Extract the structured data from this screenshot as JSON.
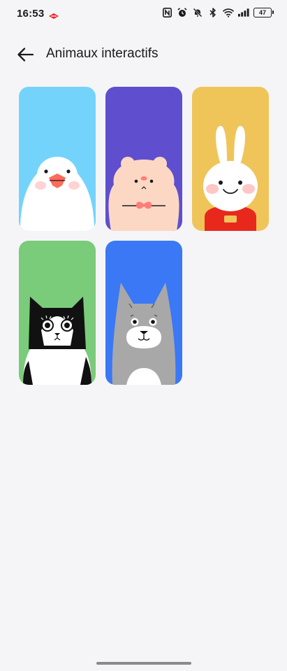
{
  "status": {
    "time": "16:53",
    "battery": "47"
  },
  "header": {
    "title": "Animaux interactifs"
  },
  "wallpapers": [
    {
      "name": "bird",
      "bg": "#74d3fb"
    },
    {
      "name": "hamster",
      "bg": "#5f4fce"
    },
    {
      "name": "rabbit",
      "bg": "#efc55a"
    },
    {
      "name": "cat",
      "bg": "#7acb7a"
    },
    {
      "name": "dog",
      "bg": "#3a78f5"
    }
  ]
}
